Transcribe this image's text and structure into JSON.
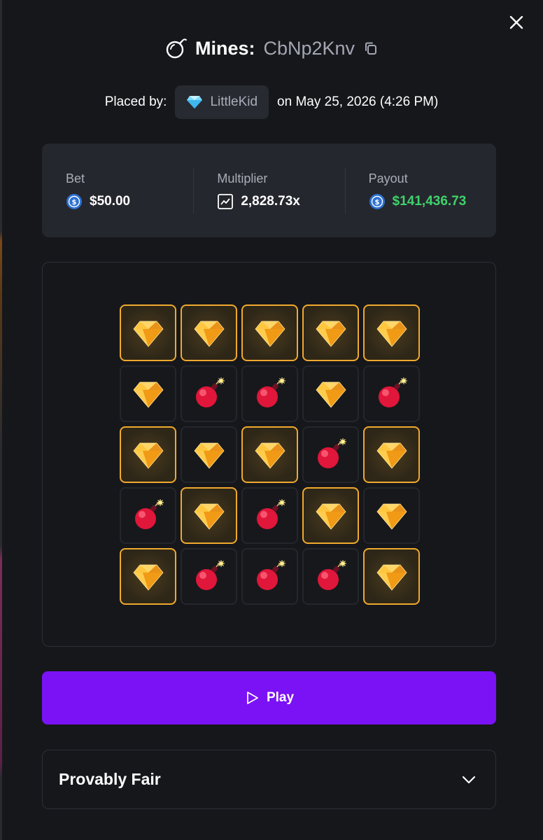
{
  "header": {
    "game_name": "Mines:",
    "bet_id": "CbNp2Knv",
    "icons": {
      "game": "bomb-icon",
      "copy": "copy-icon",
      "close": "close-icon"
    }
  },
  "placed": {
    "label": "Placed by:",
    "username": "LittleKid",
    "user_icon": "diamond-icon",
    "date": "on May 25, 2026 (4:26 PM)"
  },
  "stats": {
    "bet_label": "Bet",
    "bet_value": "$50.00",
    "multiplier_label": "Multiplier",
    "multiplier_value": "2,828.73x",
    "payout_label": "Payout",
    "payout_value": "$141,436.73",
    "payout_color": "#3fd36b"
  },
  "board": {
    "grid": [
      [
        "gem-picked",
        "gem-picked",
        "gem-picked",
        "gem-picked",
        "gem-picked"
      ],
      [
        "gem",
        "bomb",
        "bomb",
        "gem",
        "bomb"
      ],
      [
        "gem-picked",
        "gem",
        "gem-picked",
        "bomb",
        "gem-picked"
      ],
      [
        "bomb",
        "gem-picked",
        "bomb",
        "gem-picked",
        "gem"
      ],
      [
        "gem-picked",
        "bomb",
        "bomb",
        "bomb",
        "gem-picked"
      ]
    ],
    "picked_border_color": "#f0a92e"
  },
  "actions": {
    "play_label": "Play",
    "accent_color": "#7b12f5"
  },
  "fair": {
    "title": "Provably Fair",
    "icon": "chevron-down-icon"
  }
}
